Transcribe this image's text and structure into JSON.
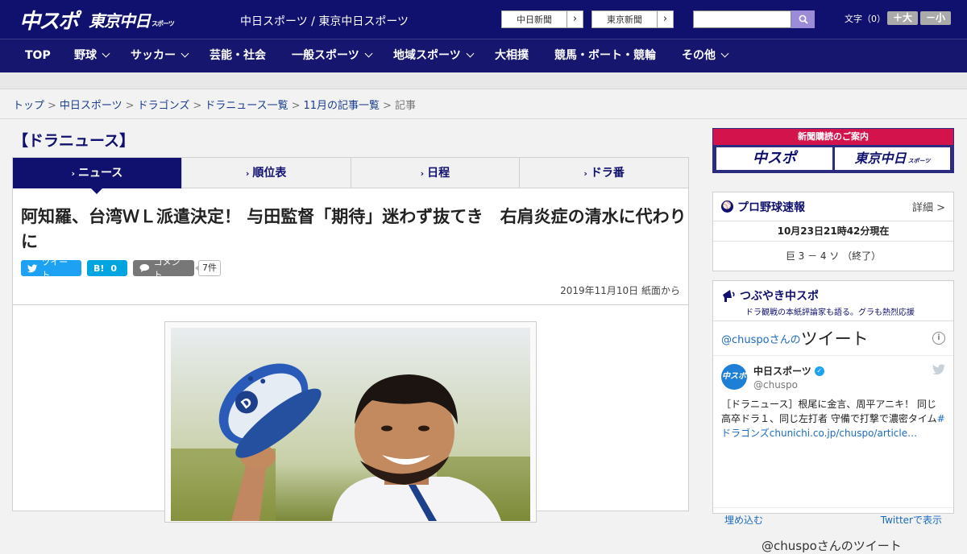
{
  "header": {
    "logo_main": "中スポ",
    "logo_sub": "東京中日",
    "logo_sub_small": "スポーツ",
    "site_title": "中日スポーツ / 東京中日スポーツ",
    "paper_links": [
      {
        "label": "中日新聞",
        "arrow": "›"
      },
      {
        "label": "東京新聞",
        "arrow": "›"
      }
    ],
    "search_placeholder": "",
    "font_size_label": "文字（0）",
    "font_bigger": "＋大",
    "font_smaller": "－小"
  },
  "nav": [
    {
      "label": "TOP",
      "dropdown": false
    },
    {
      "label": "野球",
      "dropdown": true
    },
    {
      "label": "サッカー",
      "dropdown": true
    },
    {
      "label": "芸能・社会",
      "dropdown": false
    },
    {
      "label": "一般スポーツ",
      "dropdown": true
    },
    {
      "label": "地域スポーツ",
      "dropdown": true
    },
    {
      "label": "大相撲",
      "dropdown": false
    },
    {
      "label": "競馬・ボート・競輪",
      "dropdown": false
    },
    {
      "label": "その他",
      "dropdown": true
    }
  ],
  "breadcrumb": {
    "items": [
      "トップ",
      "中日スポーツ",
      "ドラゴンズ",
      "ドラニュース一覧",
      "11月の記事一覧"
    ],
    "separator": ">",
    "current": "記事"
  },
  "section_title": "【ドラニュース】",
  "tabs": [
    {
      "label": "ニュース",
      "active": true
    },
    {
      "label": "順位表",
      "active": false
    },
    {
      "label": "日程",
      "active": false
    },
    {
      "label": "ドラ番",
      "active": false
    }
  ],
  "article": {
    "headline": "阿知羅、台湾ＷＬ派遣決定！ 与田監督「期待」迷わず抜てき　右肩炎症の清水に代わりに",
    "tweet_label": "ツイート",
    "hatena_label": "B!",
    "hatena_count": "0",
    "comment_label": "コメント",
    "comment_count": "7件",
    "date": "2019年11月10日 紙面から"
  },
  "sidebar": {
    "subscribe_banner": {
      "title": "新聞購読のご案内",
      "logo1": "中スポ",
      "logo2": "東京中日",
      "logo2_small": "スポーツ"
    },
    "scores": {
      "title": "プロ野球速報",
      "detail": "詳細 >",
      "timestamp": "10月23日21時42分現在",
      "game": "巨 3 － 4 ソ （終了）"
    },
    "tsubuyaki": {
      "title": "つぶやき中スポ",
      "subtitle": "ドラ観戦の本紙評論家も語る。グラも熱烈応援",
      "embed_handle": "@chuspoさんの",
      "embed_title": "ツイート",
      "tweet": {
        "name": "中日スポーツ",
        "screen_name": "@chuspo",
        "text": "［ドラニュース］根尾に金言、周平アニキ！ 同じ高卒ドラ１、同じ左打者 守備で打撃で濃密タイム",
        "link_text": "#ドラゴンズchunichi.co.jp/chuspo/article…"
      },
      "embed_link": "埋め込む",
      "view_on_twitter": "Twitterで表示",
      "next_title": "@chuspoさんのツイート"
    }
  },
  "colors": {
    "brand_navy": "#10106e",
    "nav_bg": "#16166e",
    "accent_red": "#d3134b",
    "tweet_blue": "#1da1f2",
    "hatena_blue": "#00a4de"
  }
}
